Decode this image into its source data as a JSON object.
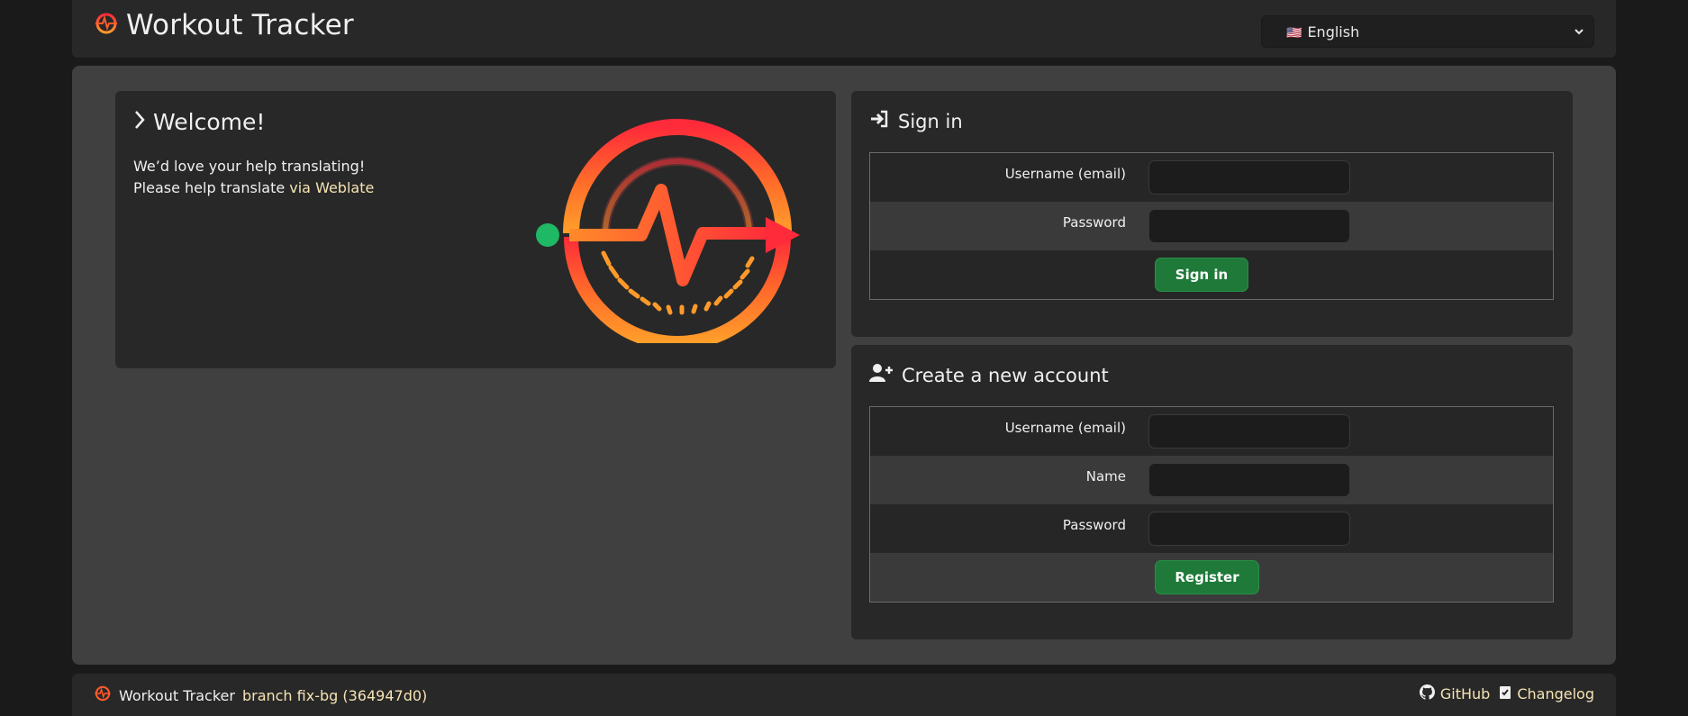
{
  "header": {
    "title": "Workout Tracker",
    "language": {
      "flag": "🇺🇸",
      "label": "English"
    }
  },
  "welcome": {
    "title": "Welcome!",
    "line1": "We’d love your help translating!",
    "line2_prefix": "Please help translate ",
    "line2_link": "via Weblate"
  },
  "signin": {
    "title": "Sign in",
    "username_label": "Username (email)",
    "password_label": "Password",
    "button_label": "Sign in"
  },
  "register": {
    "title": "Create a new account",
    "username_label": "Username (email)",
    "name_label": "Name",
    "password_label": "Password",
    "button_label": "Register"
  },
  "footer": {
    "app_name": "Workout Tracker",
    "branch_info": "branch fix-bg (364947d0)",
    "github_label": "GitHub",
    "changelog_label": "Changelog"
  },
  "colors": {
    "accent_button": "#1f7a3a",
    "link": "#f5e3b3",
    "logo_gradient_start": "#ff2a3a",
    "logo_gradient_end": "#ff9e2a",
    "logo_dot": "#1fb865"
  },
  "icons": [
    "logo-icon",
    "chevron-right-icon",
    "sign-in-icon",
    "user-plus-icon",
    "github-icon",
    "checklist-icon",
    "chevron-down-icon"
  ]
}
